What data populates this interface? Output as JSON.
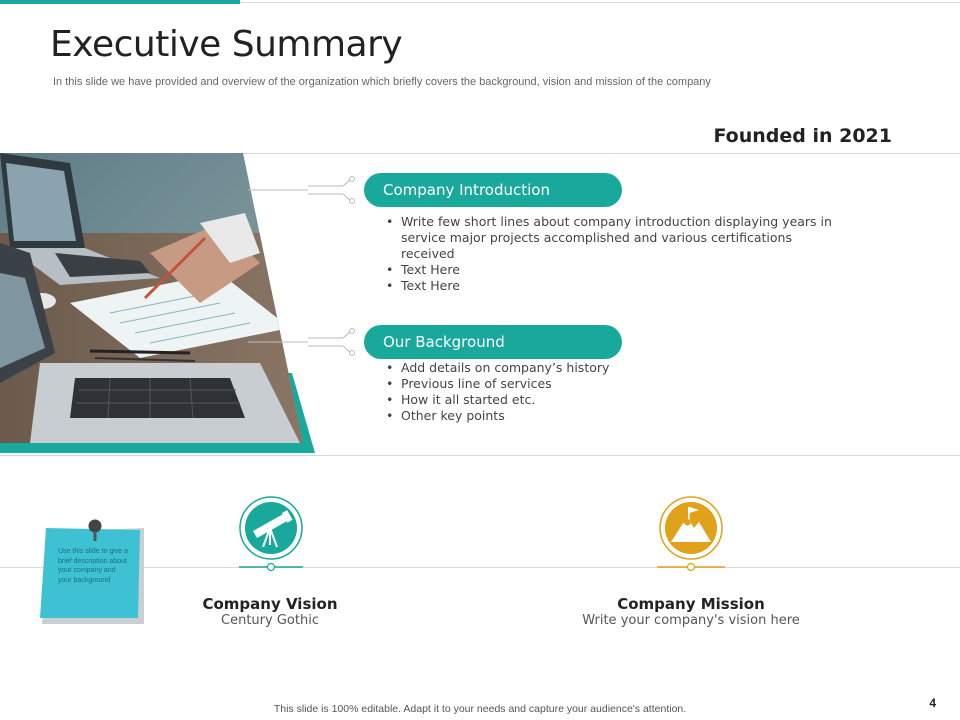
{
  "slide": {
    "title": "Executive Summary",
    "subtitle": "In this slide we have provided and overview of the organization which briefly covers  the background, vision  and mission of the company",
    "founded": "Founded in 2021",
    "page_number": "4",
    "footer": "This slide is 100% editable. Adapt it to your needs and capture your audience's attention."
  },
  "sections": [
    {
      "heading": "Company Introduction",
      "bullets": [
        "Write few short lines about company introduction displaying years in service major projects accomplished and various certifications received",
        "Text Here",
        "Text Here"
      ]
    },
    {
      "heading": "Our Background",
      "bullets": [
        "Add details on company’s history",
        "Previous line of services",
        "How it all started etc.",
        "Other key points"
      ]
    }
  ],
  "sticky_note": {
    "text": "Use this slide to give a brief description about your company and your background"
  },
  "features": [
    {
      "title": "Company Vision",
      "description": "Century Gothic",
      "icon": "telescope-icon",
      "color": "#19a89c"
    },
    {
      "title": "Company Mission",
      "description": "Write your company's vision here",
      "icon": "mountain-flag-icon",
      "color": "#e0a21a"
    }
  ],
  "colors": {
    "accent": "#19a89c",
    "mission": "#e0a21a",
    "sticky": "#3ec1d3"
  }
}
